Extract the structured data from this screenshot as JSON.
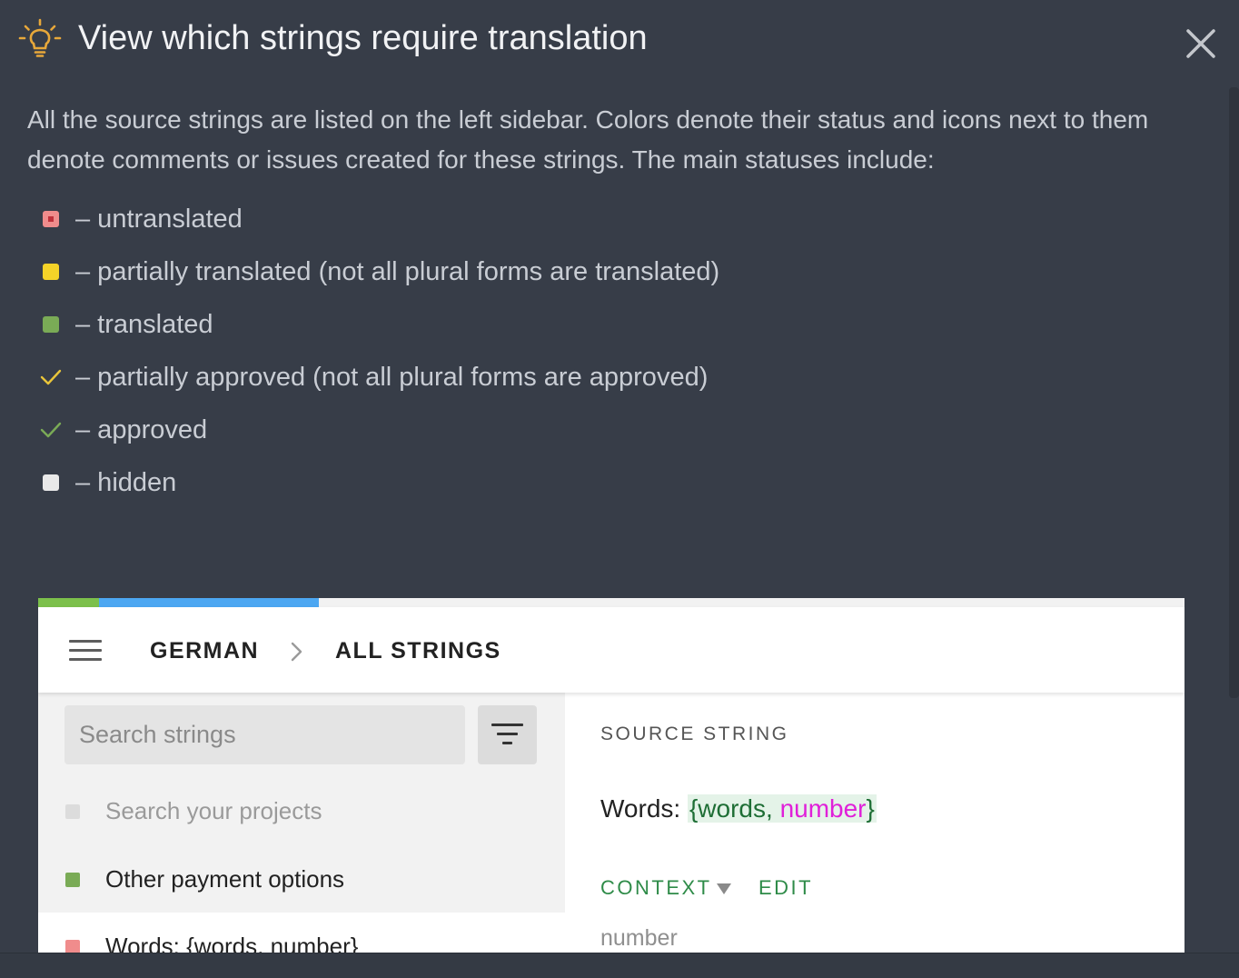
{
  "header": {
    "title": "View which strings require translation",
    "accent_color": "#e8a83a"
  },
  "intro": "All the source strings are listed on the left sidebar. Colors denote their status and icons next to them denote comments or issues created for these strings. The main statuses include:",
  "legend": [
    {
      "icon": "red-square-icon",
      "label": "– untranslated",
      "color": "#f08c8c"
    },
    {
      "icon": "yellow-square-icon",
      "label": "– partially translated (not all plural forms are translated)",
      "color": "#f5d328"
    },
    {
      "icon": "green-square-icon",
      "label": "– translated",
      "color": "#7aab56"
    },
    {
      "icon": "yellow-check-icon",
      "label": "– partially approved (not all plural forms are approved)",
      "color": "#e9c53a"
    },
    {
      "icon": "green-check-icon",
      "label": "– approved",
      "color": "#7aab56"
    },
    {
      "icon": "white-square-icon",
      "label": "– hidden",
      "color": "#e9e9e9"
    }
  ],
  "editor": {
    "progress": {
      "translated_pct": 5.3,
      "approved_pct": 19.2
    },
    "breadcrumb": {
      "language": "GERMAN",
      "section": "ALL STRINGS"
    },
    "search": {
      "placeholder": "Search strings",
      "value": ""
    },
    "strings": [
      {
        "label": "Search your projects",
        "status": "hidden",
        "color": "#dcdcdc",
        "text_color": "#9a9a9a"
      },
      {
        "label": "Other payment options",
        "status": "translated",
        "color": "#7aab56",
        "text_color": "#222222"
      },
      {
        "label": "Words: {words, number}",
        "status": "untranslated",
        "color": "#f08c8c",
        "text_color": "#222222"
      }
    ],
    "source": {
      "label": "SOURCE STRING",
      "prefix": "Words: ",
      "ph_open": "{words, ",
      "ph_arg": "number",
      "ph_close": "}"
    },
    "context": {
      "label": "CONTEXT",
      "edit_label": "EDIT",
      "value": "number"
    }
  }
}
